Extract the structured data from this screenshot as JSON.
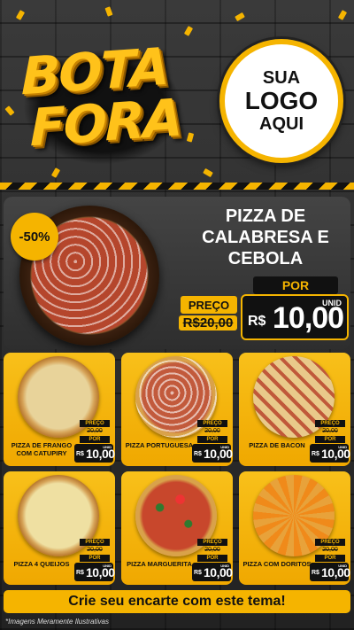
{
  "header": {
    "title_line1": "BOTA",
    "title_line2": "FORA",
    "logo_line1": "SUA",
    "logo_line2": "LOGO",
    "logo_line3": "AQUI"
  },
  "featured": {
    "discount": "-50%",
    "name_line1": "PIZZA DE",
    "name_line2": "CALABRESA E",
    "name_line3": "CEBOLA",
    "preco_label": "PREÇO",
    "old_currency": "R$",
    "old_price": "20,00",
    "por_label": "POR",
    "currency": "R$",
    "price": "10,00",
    "unit": "UNID"
  },
  "products": [
    {
      "name": "PIZZA DE FRANGO COM CATUPIRY",
      "preco_label": "PREÇO",
      "old_price": "20,00",
      "por_label": "POR",
      "currency": "R$",
      "price": "10,00",
      "unit": "UNID"
    },
    {
      "name": "PIZZA PORTUGUESA",
      "preco_label": "PREÇO",
      "old_price": "20,00",
      "por_label": "POR",
      "currency": "R$",
      "price": "10,00",
      "unit": "UNID"
    },
    {
      "name": "PIZZA DE BACON",
      "preco_label": "PREÇO",
      "old_price": "20,00",
      "por_label": "POR",
      "currency": "R$",
      "price": "10,00",
      "unit": "UNID"
    },
    {
      "name": "PIZZA 4 QUEIJOS",
      "preco_label": "PREÇO",
      "old_price": "20,00",
      "por_label": "POR",
      "currency": "R$",
      "price": "10,00",
      "unit": "UNID"
    },
    {
      "name": "PIZZA MARGUERITA",
      "preco_label": "PREÇO",
      "old_price": "20,00",
      "por_label": "POR",
      "currency": "R$",
      "price": "10,00",
      "unit": "UNID"
    },
    {
      "name": "PIZZA COM DORITOS",
      "preco_label": "PREÇO",
      "old_price": "20,00",
      "por_label": "POR",
      "currency": "R$",
      "price": "10,00",
      "unit": "UNID"
    }
  ],
  "cta": "Crie seu encarte com este tema!",
  "disclaimer": "*Imagens Meramente Ilustrativas",
  "colors": {
    "accent": "#f5b400",
    "dark": "#111111",
    "background": "#2b2b2b"
  }
}
